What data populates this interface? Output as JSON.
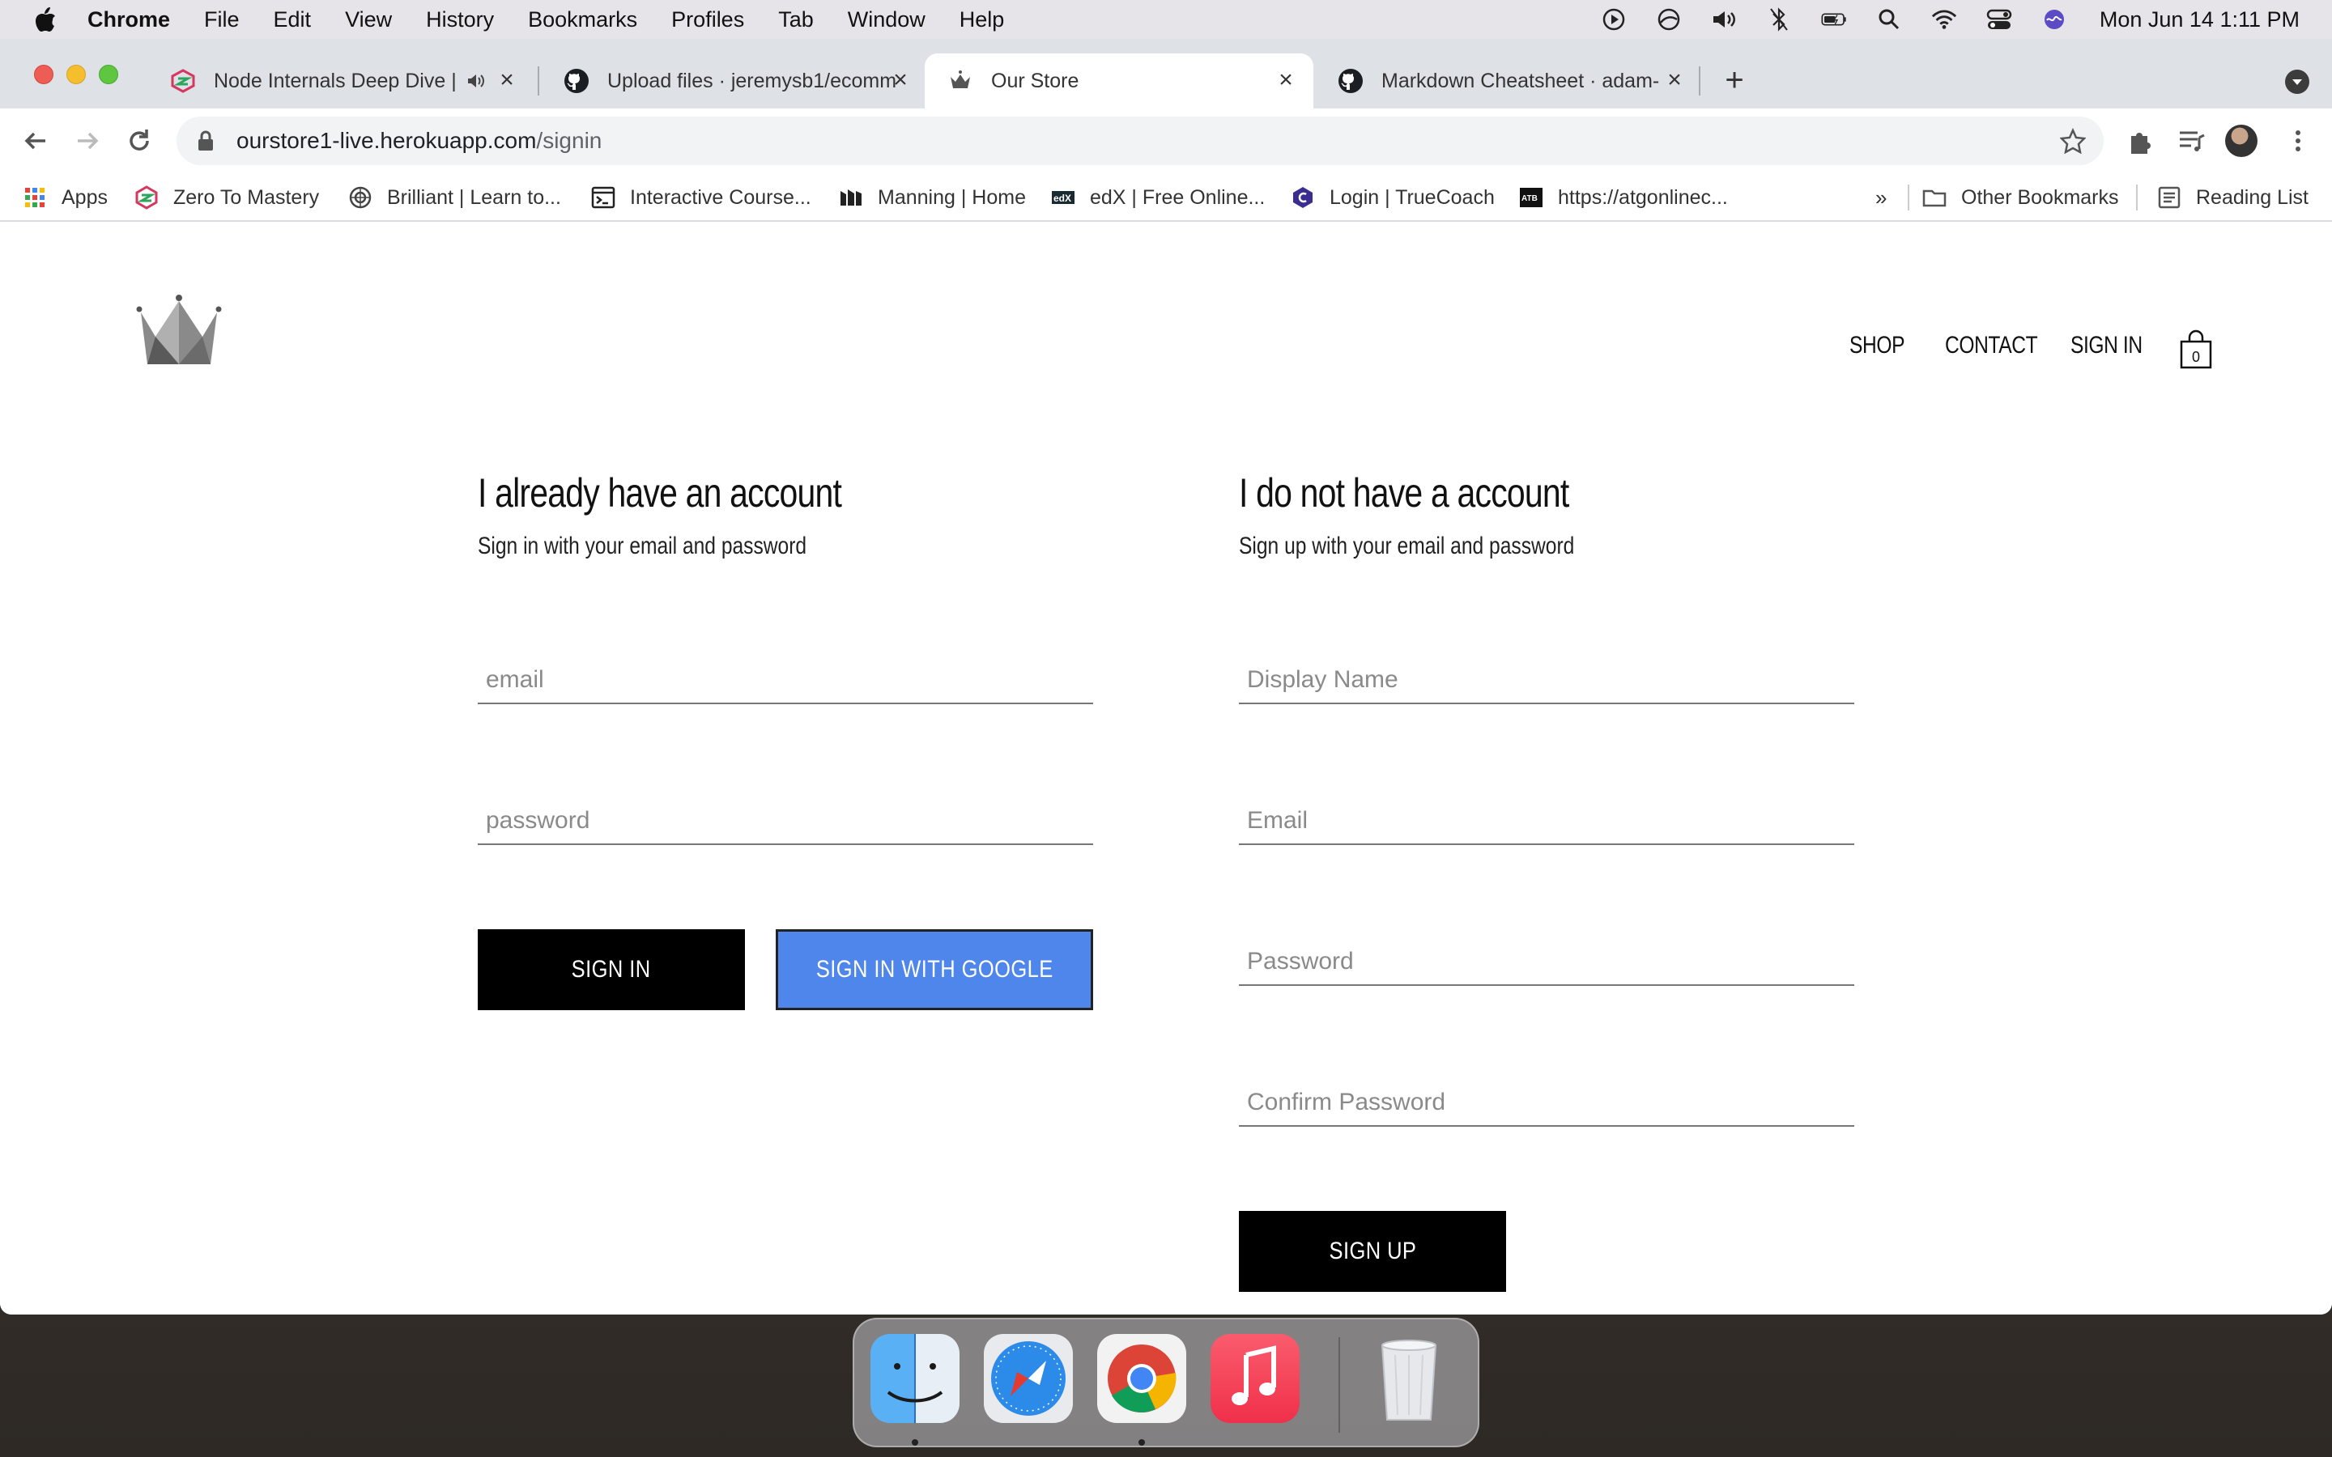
{
  "menubar": {
    "app_name": "Chrome",
    "items": [
      "File",
      "Edit",
      "View",
      "History",
      "Bookmarks",
      "Profiles",
      "Tab",
      "Window",
      "Help"
    ],
    "clock": "Mon Jun 14  1:11 PM"
  },
  "tabs": [
    {
      "title": "Node Internals Deep Dive |",
      "icon": "ztm-icon",
      "audio": true
    },
    {
      "title": "Upload files · jeremysb1/ecomm",
      "icon": "github-icon"
    },
    {
      "title": "Our Store",
      "icon": "crown-icon",
      "active": true
    },
    {
      "title": "Markdown Cheatsheet · adam-",
      "icon": "github-icon"
    }
  ],
  "address": {
    "host": "ourstore1-live.herokuapp.com",
    "path": "/signin"
  },
  "bookmarks": [
    {
      "label": "Apps",
      "icon": "apps-grid-icon"
    },
    {
      "label": "Zero To Mastery",
      "icon": "ztm-icon"
    },
    {
      "label": "Brilliant | Learn to...",
      "icon": "brilliant-icon"
    },
    {
      "label": "Interactive Course...",
      "icon": "terminal-icon"
    },
    {
      "label": "Manning | Home",
      "icon": "manning-icon"
    },
    {
      "label": "edX | Free Online...",
      "icon": "edx-icon"
    },
    {
      "label": "Login | TrueCoach",
      "icon": "truecoach-icon"
    },
    {
      "label": "https://atgonlinec...",
      "icon": "atb-icon"
    }
  ],
  "bookmarks_overflow": "»",
  "other_bookmarks": "Other Bookmarks",
  "reading_list": "Reading List",
  "site": {
    "nav": {
      "shop": "SHOP",
      "contact": "CONTACT",
      "sign_in": "SIGN IN",
      "cart_count": "0"
    },
    "signin": {
      "title": "I already have an account",
      "subtitle": "Sign in with your email and password",
      "email_placeholder": "email",
      "password_placeholder": "password",
      "sign_in_button": "SIGN IN",
      "google_button": "SIGN IN WITH GOOGLE"
    },
    "signup": {
      "title": "I do not have a account",
      "subtitle": "Sign up with your email and password",
      "display_name_placeholder": "Display Name",
      "email_placeholder": "Email",
      "password_placeholder": "Password",
      "confirm_placeholder": "Confirm Password",
      "sign_up_button": "SIGN UP"
    }
  },
  "dock": [
    "Finder",
    "Safari",
    "Google Chrome",
    "Music",
    "Trash"
  ],
  "colors": {
    "google_blue": "#4f86ec",
    "tab_strip": "#dee1e6",
    "accent_black": "#000000"
  }
}
